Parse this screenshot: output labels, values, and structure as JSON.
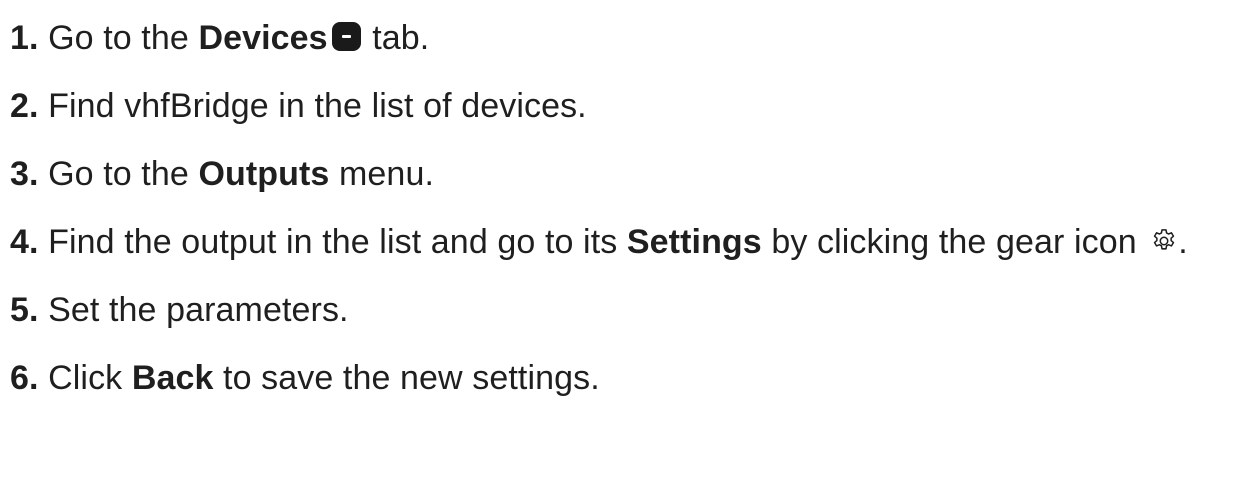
{
  "steps": [
    {
      "num": "1.",
      "pre": " Go to the ",
      "bold": "Devices",
      "post": " tab."
    },
    {
      "num": "2.",
      "pre": " Find vhfBridge in the list of devices."
    },
    {
      "num": "3.",
      "pre": " Go to the ",
      "bold": "Outputs",
      "post": " menu."
    },
    {
      "num": "4.",
      "pre": " Find the output in the list and go to its ",
      "bold": "Settings",
      "post": " by clicking the gear icon ",
      "end": "."
    },
    {
      "num": "5.",
      "pre": " Set the parameters."
    },
    {
      "num": "6.",
      "pre": " Click ",
      "bold": "Back",
      "post": " to save the new settings."
    }
  ],
  "icons": {
    "devices_tab": "devices-tab-icon",
    "gear": "gear-icon"
  }
}
